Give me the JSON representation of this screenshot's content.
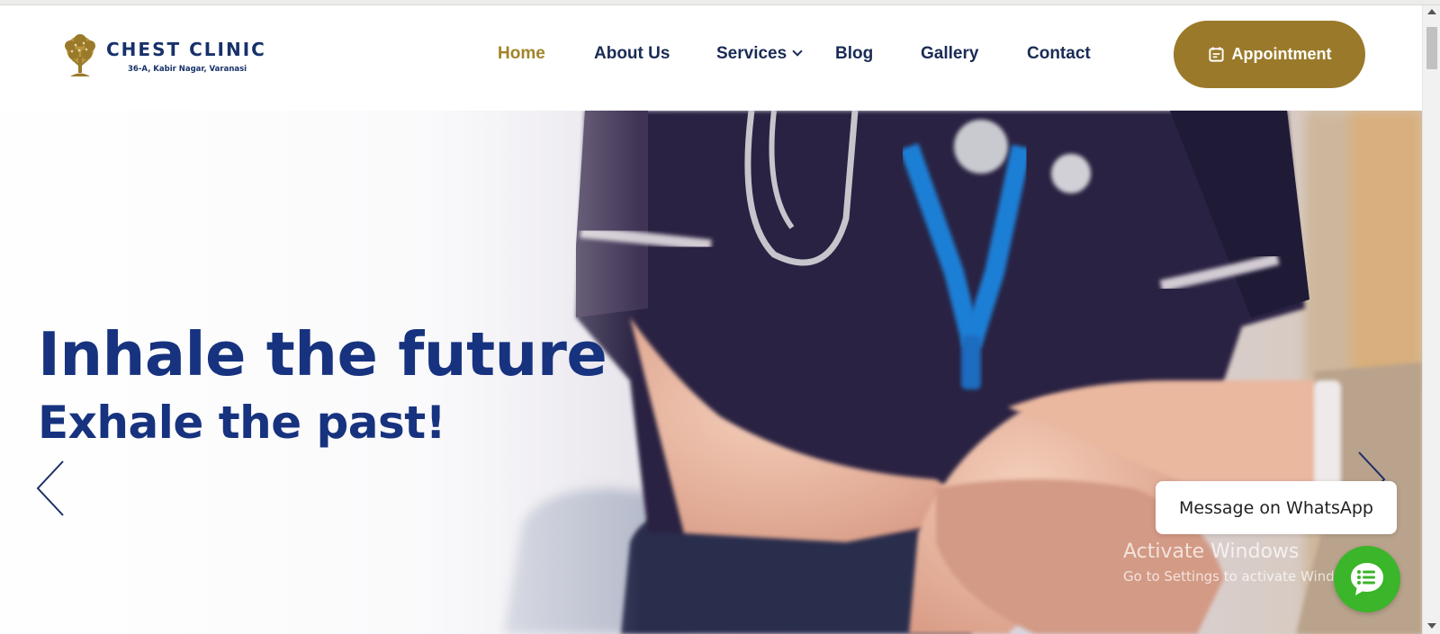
{
  "brand": {
    "name": "CHEST CLINIC",
    "address": "36-A, Kabir Nagar, Varanasi",
    "logo_icon": "tree-logo-icon"
  },
  "nav": {
    "items": [
      {
        "label": "Home",
        "active": true
      },
      {
        "label": "About Us"
      },
      {
        "label": "Services",
        "has_dropdown": true
      },
      {
        "label": "Blog"
      },
      {
        "label": "Gallery"
      },
      {
        "label": "Contact"
      }
    ],
    "appointment_label": "Appointment",
    "appointment_icon": "calendar-icon"
  },
  "hero": {
    "headline_line1": "Inhale the future",
    "headline_line2": "Exhale the past!",
    "prev_icon": "chevron-left-icon",
    "next_icon": "chevron-right-icon"
  },
  "whatsapp": {
    "bubble_text": "Message on WhatsApp",
    "button_icon": "chat-list-icon"
  },
  "os_overlay": {
    "title": "Activate Windows",
    "subtitle": "Go to Settings to activate Windows."
  },
  "colors": {
    "brand_navy": "#17337f",
    "nav_text": "#1a2b55",
    "accent_gold": "#9a7a2a",
    "active_nav": "#a1842a",
    "whatsapp_green": "#3bb52a"
  }
}
